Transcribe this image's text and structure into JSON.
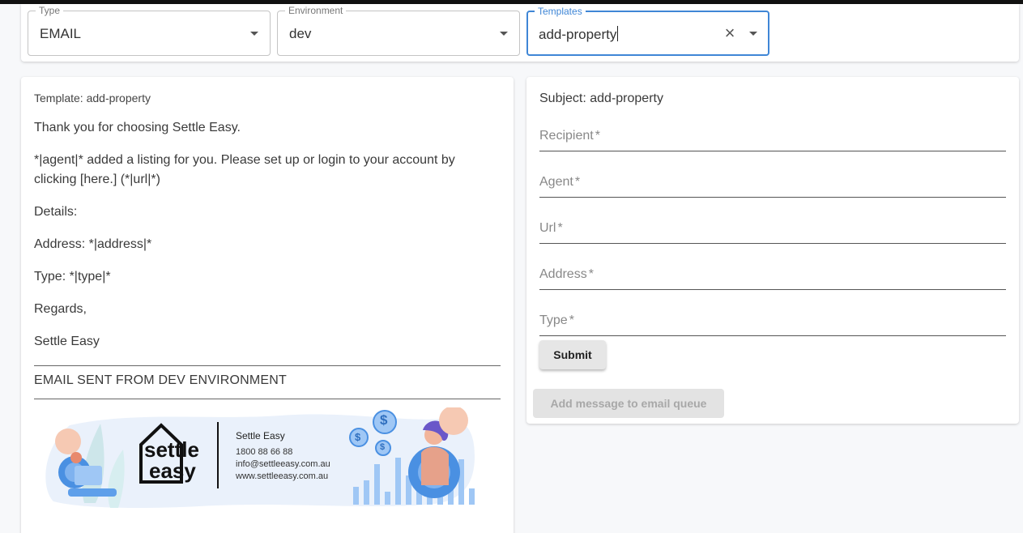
{
  "filters": {
    "type": {
      "legend": "Type",
      "value": "EMAIL"
    },
    "environment": {
      "legend": "Environment",
      "value": "dev"
    },
    "templates": {
      "legend": "Templates",
      "value": "add-property",
      "clear_icon": "close-icon"
    }
  },
  "preview": {
    "template_label": "Template: add-property",
    "paragraphs": [
      "Thank you for choosing Settle Easy.",
      "*|agent|* added a listing for you. Please set up or login to your account by clicking [here.] (*|url|*)",
      "Details:",
      "Address: *|address|*",
      "Type: *|type|*",
      "Regards,",
      "Settle Easy"
    ],
    "env_note": "EMAIL SENT FROM DEV ENVIRONMENT",
    "banner": {
      "logo_top": "settle",
      "logo_bottom": "easy",
      "company": "Settle Easy",
      "phone": "1800 88 66 88",
      "email": "info@settleeasy.com.au",
      "website": "www.settleeasy.com.au",
      "coin_symbol": "$"
    }
  },
  "form": {
    "subject": "Subject: add-property",
    "fields": [
      {
        "label": "Recipient",
        "required": "*"
      },
      {
        "label": "Agent",
        "required": "*"
      },
      {
        "label": "Url",
        "required": "*"
      },
      {
        "label": "Address",
        "required": "*"
      },
      {
        "label": "Type",
        "required": "*"
      }
    ],
    "submit_label": "Submit",
    "queue_label": "Add message to email queue"
  },
  "colors": {
    "focus": "#3f86d6",
    "banner_bg": "#eaf1fb",
    "banner_accent": "#4a90e2"
  }
}
